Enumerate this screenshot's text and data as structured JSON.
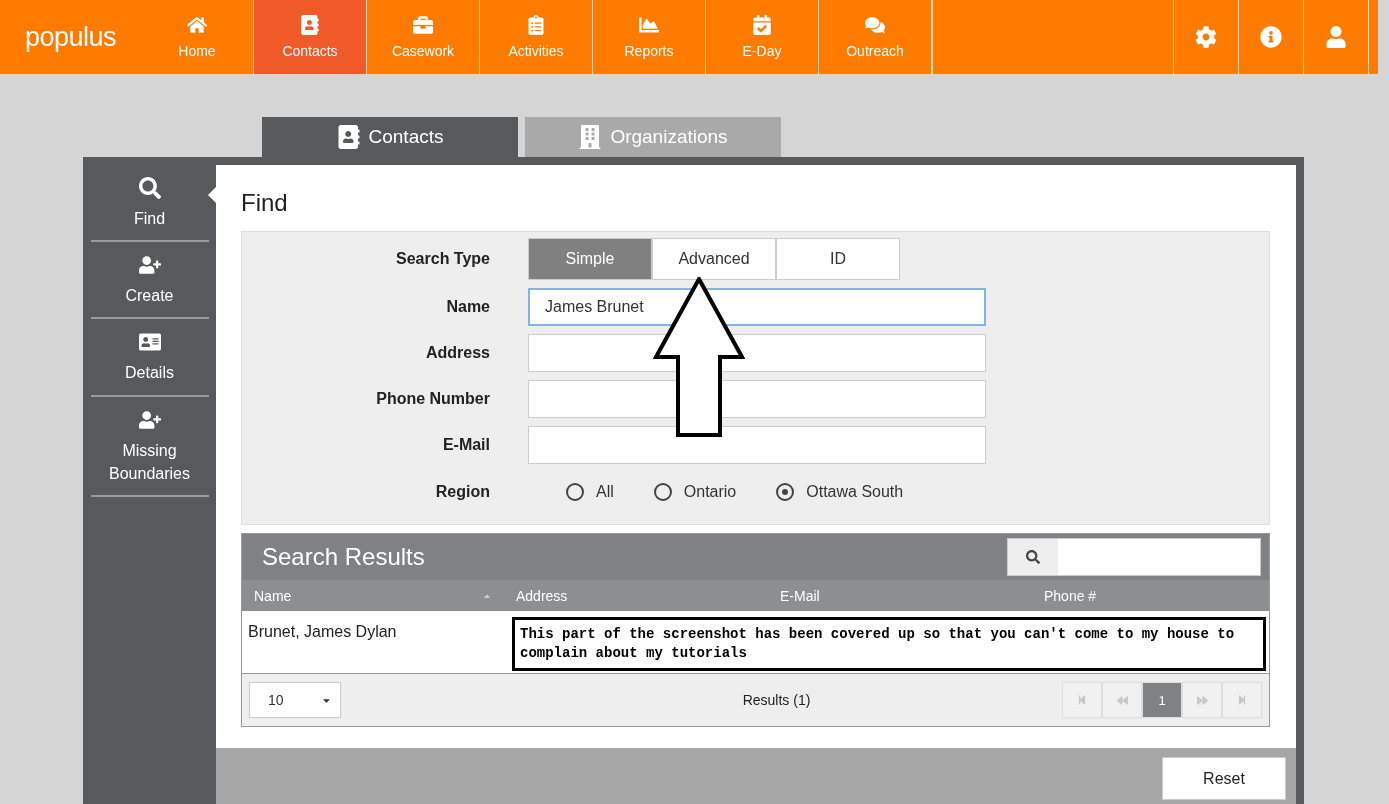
{
  "top_bar": {
    "logo": "populus",
    "nav": [
      {
        "label": "Home",
        "kind": "home",
        "selected": false
      },
      {
        "label": "Contacts",
        "kind": "contacts",
        "selected": true
      },
      {
        "label": "Casework",
        "kind": "casework",
        "selected": false
      },
      {
        "label": "Activities",
        "kind": "activities",
        "selected": false
      },
      {
        "label": "Reports",
        "kind": "reports",
        "selected": false
      },
      {
        "label": "E-Day",
        "kind": "eday",
        "selected": false
      },
      {
        "label": "Outreach",
        "kind": "outreach",
        "selected": false
      }
    ],
    "tools": [
      {
        "kind": "settings"
      },
      {
        "kind": "info"
      },
      {
        "kind": "user"
      }
    ]
  },
  "tabs": [
    {
      "label": "Contacts",
      "kind": "contacts",
      "selected": true
    },
    {
      "label": "Organizations",
      "kind": "building",
      "selected": false
    }
  ],
  "sidebar": {
    "items": [
      {
        "label": "Find",
        "kind": "search",
        "selected": true
      },
      {
        "label": "Create",
        "kind": "create",
        "selected": false
      },
      {
        "label": "Details",
        "kind": "details",
        "selected": false
      },
      {
        "label": "Missing Boundaries",
        "kind": "create",
        "selected": false
      }
    ]
  },
  "find": {
    "title": "Find",
    "search_type": {
      "label": "Search Type",
      "options": [
        {
          "label": "Simple",
          "selected": true
        },
        {
          "label": "Advanced",
          "selected": false
        },
        {
          "label": "ID",
          "selected": false
        }
      ]
    },
    "fields": [
      {
        "label": "Name",
        "value": "James Brunet",
        "focused": true
      },
      {
        "label": "Address",
        "focused": false
      },
      {
        "label": "Phone Number",
        "focused": false
      },
      {
        "label": "E-Mail",
        "focused": false
      }
    ],
    "region": {
      "label": "Region",
      "options": [
        {
          "label": "All",
          "selected": false
        },
        {
          "label": "Ontario",
          "selected": false
        },
        {
          "label": "Ottawa South",
          "selected": true
        }
      ]
    }
  },
  "results": {
    "title": "Search Results",
    "columns": [
      {
        "label": "Name",
        "sorted": true
      },
      {
        "label": "Address",
        "sorted": false
      },
      {
        "label": "E-Mail",
        "sorted": false
      },
      {
        "label": "Phone #",
        "sorted": false
      }
    ],
    "rows": [
      {
        "name": "Brunet, James Dylan"
      }
    ],
    "cover_note": "This part of the screenshot has been covered up so that you can't come to my house to complain about my tutorials",
    "page_size": "10",
    "count": "Results (1)",
    "pages": [
      {
        "label": "1",
        "selected": true
      }
    ]
  },
  "reset": "Reset"
}
